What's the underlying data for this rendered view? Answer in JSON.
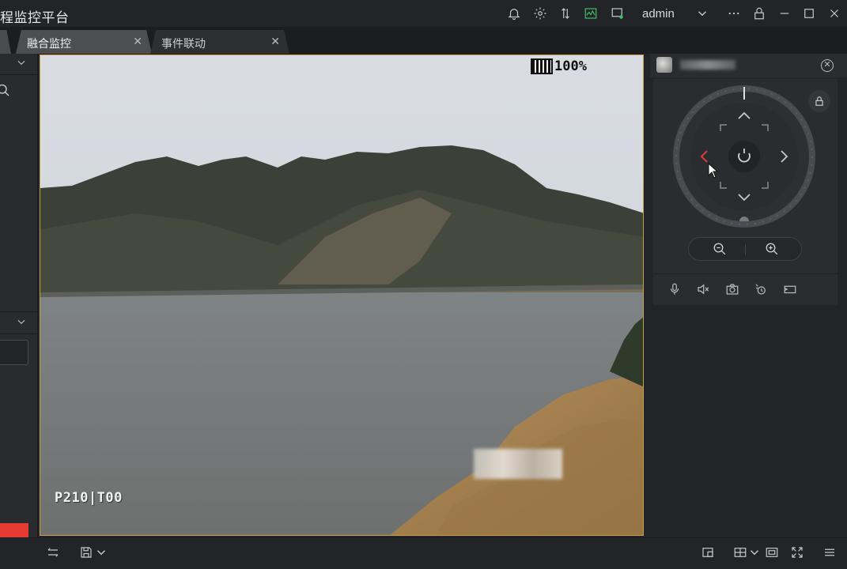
{
  "app": {
    "title": "程监控平台",
    "user": "admin"
  },
  "tabs": [
    {
      "label": "融合监控",
      "active": true
    },
    {
      "label": "事件联动",
      "active": false
    }
  ],
  "video": {
    "battery_text": "100%",
    "osd_code": "P210|T00"
  },
  "icons": {
    "titlebar": [
      "bell-icon",
      "settings-icon",
      "transfer-icon",
      "monitor-wave-icon",
      "screen-status-icon",
      "chevron-down-icon",
      "more-icon",
      "lock-icon",
      "minimize-icon",
      "maximize-icon",
      "close-icon"
    ],
    "ptz_tools": [
      "microphone-icon",
      "mute-icon",
      "snapshot-icon",
      "record-icon",
      "stream-icon"
    ],
    "bottombar": [
      "list-icon",
      "save-icon",
      "window-icon",
      "grid-layout-icon",
      "multi-screen-icon",
      "fullscreen-icon",
      "menu-icon"
    ]
  },
  "colors": {
    "accent_red": "#e53a2f",
    "video_border": "#c9a04a",
    "ptz_arrow_active": "#d8403a"
  }
}
